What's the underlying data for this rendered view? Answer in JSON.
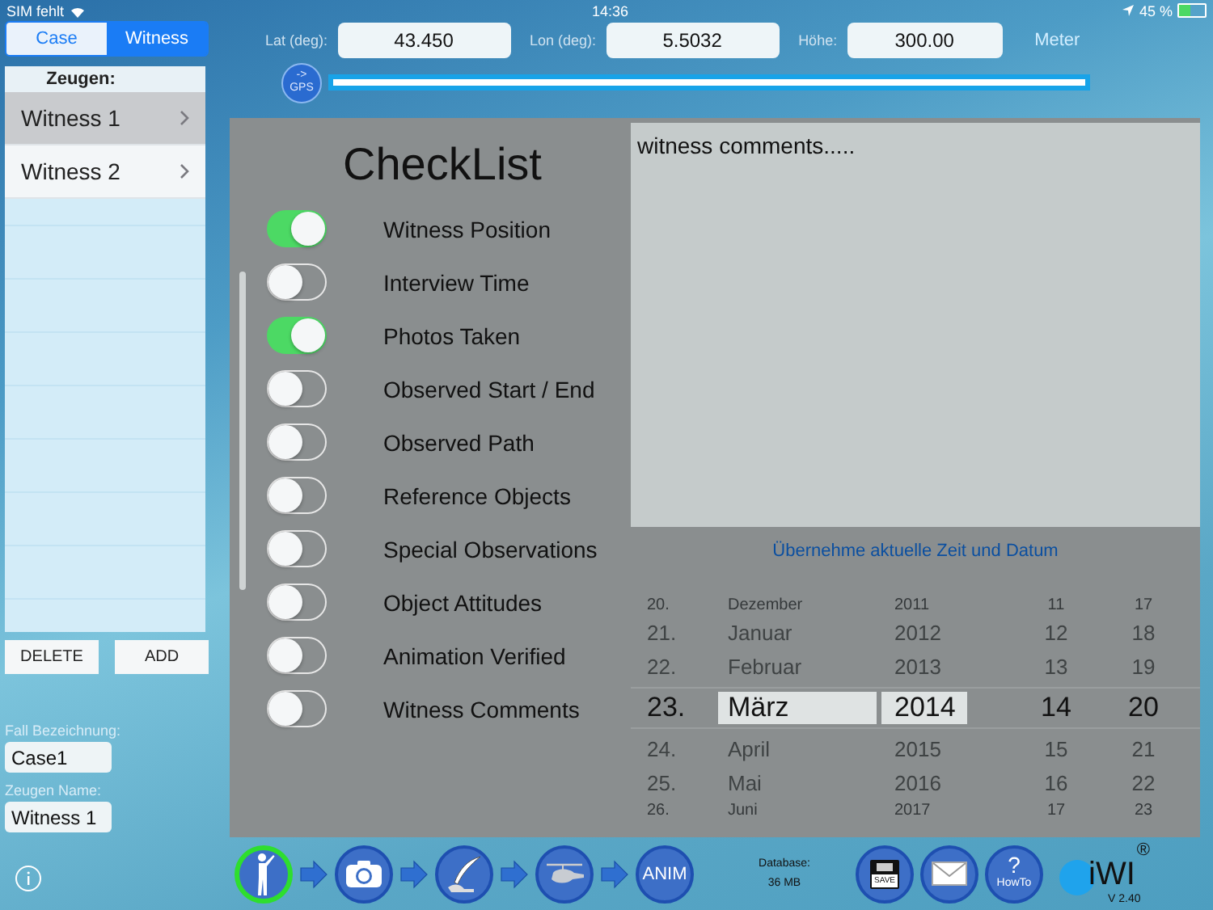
{
  "status_bar": {
    "carrier": "SIM fehlt",
    "time": "14:36",
    "battery": "45 %"
  },
  "sidebar": {
    "tabs": [
      {
        "label": "Case",
        "selected": false
      },
      {
        "label": "Witness",
        "selected": true
      }
    ],
    "list_header": "Zeugen:",
    "items": [
      {
        "label": "Witness 1",
        "selected": true
      },
      {
        "label": "Witness 2",
        "selected": false
      }
    ],
    "buttons": [
      "DELETE",
      "ADD"
    ],
    "fields": [
      {
        "label": "Fall Bezeichnung:",
        "value": "Case1"
      },
      {
        "label": "Zeugen Name:",
        "value": "Witness 1"
      }
    ]
  },
  "location": {
    "fields": [
      {
        "label": "Lat (deg):",
        "value": "43.450"
      },
      {
        "label": "Lon (deg):",
        "value": "5.5032"
      },
      {
        "label": "Höhe:",
        "value": "300.00"
      }
    ],
    "unit": "Meter",
    "gps_button": [
      "->",
      "GPS"
    ]
  },
  "checklist": {
    "title": "CheckList",
    "items": [
      {
        "label": "Witness Position",
        "on": true
      },
      {
        "label": "Interview Time",
        "on": false
      },
      {
        "label": "Photos Taken",
        "on": true
      },
      {
        "label": "Observed Start / End",
        "on": false
      },
      {
        "label": "Observed Path",
        "on": false
      },
      {
        "label": "Reference Objects",
        "on": false
      },
      {
        "label": "Special Observations",
        "on": false
      },
      {
        "label": "Object Attitudes",
        "on": false
      },
      {
        "label": "Animation Verified",
        "on": false
      },
      {
        "label": "Witness Comments",
        "on": false
      }
    ]
  },
  "comments": {
    "value": "witness comments....."
  },
  "date_link": "Übernehme aktuelle Zeit und Datum",
  "date_picker": {
    "rows": [
      {
        "cells": [
          "20.",
          "Dezember",
          "2011",
          "11",
          "17"
        ],
        "selected": false
      },
      {
        "cells": [
          "21.",
          "Januar",
          "2012",
          "12",
          "18"
        ],
        "selected": false
      },
      {
        "cells": [
          "22.",
          "Februar",
          "2013",
          "13",
          "19"
        ],
        "selected": false
      },
      {
        "cells": [
          "23.",
          "März",
          "2014",
          "14",
          "20"
        ],
        "selected": true
      },
      {
        "cells": [
          "24.",
          "April",
          "2015",
          "15",
          "21"
        ],
        "selected": false
      },
      {
        "cells": [
          "25.",
          "Mai",
          "2016",
          "16",
          "22"
        ],
        "selected": false
      },
      {
        "cells": [
          "26.",
          "Juni",
          "2017",
          "17",
          "23"
        ],
        "selected": false
      }
    ]
  },
  "toolbar": {
    "steps": [
      {
        "kind": "figure",
        "selected": true
      },
      {
        "kind": "camera",
        "selected": false
      },
      {
        "kind": "quill",
        "selected": false
      },
      {
        "kind": "helicopter",
        "selected": false
      },
      {
        "kind": "text",
        "label": "ANIM",
        "selected": false
      }
    ],
    "database_label": "Database:",
    "database_size": "36 MB",
    "save_label": "SAVE",
    "howto": [
      "?",
      "HowTo"
    ],
    "logo": "iWI",
    "logo_mark": "®",
    "version": "V 2.40"
  }
}
